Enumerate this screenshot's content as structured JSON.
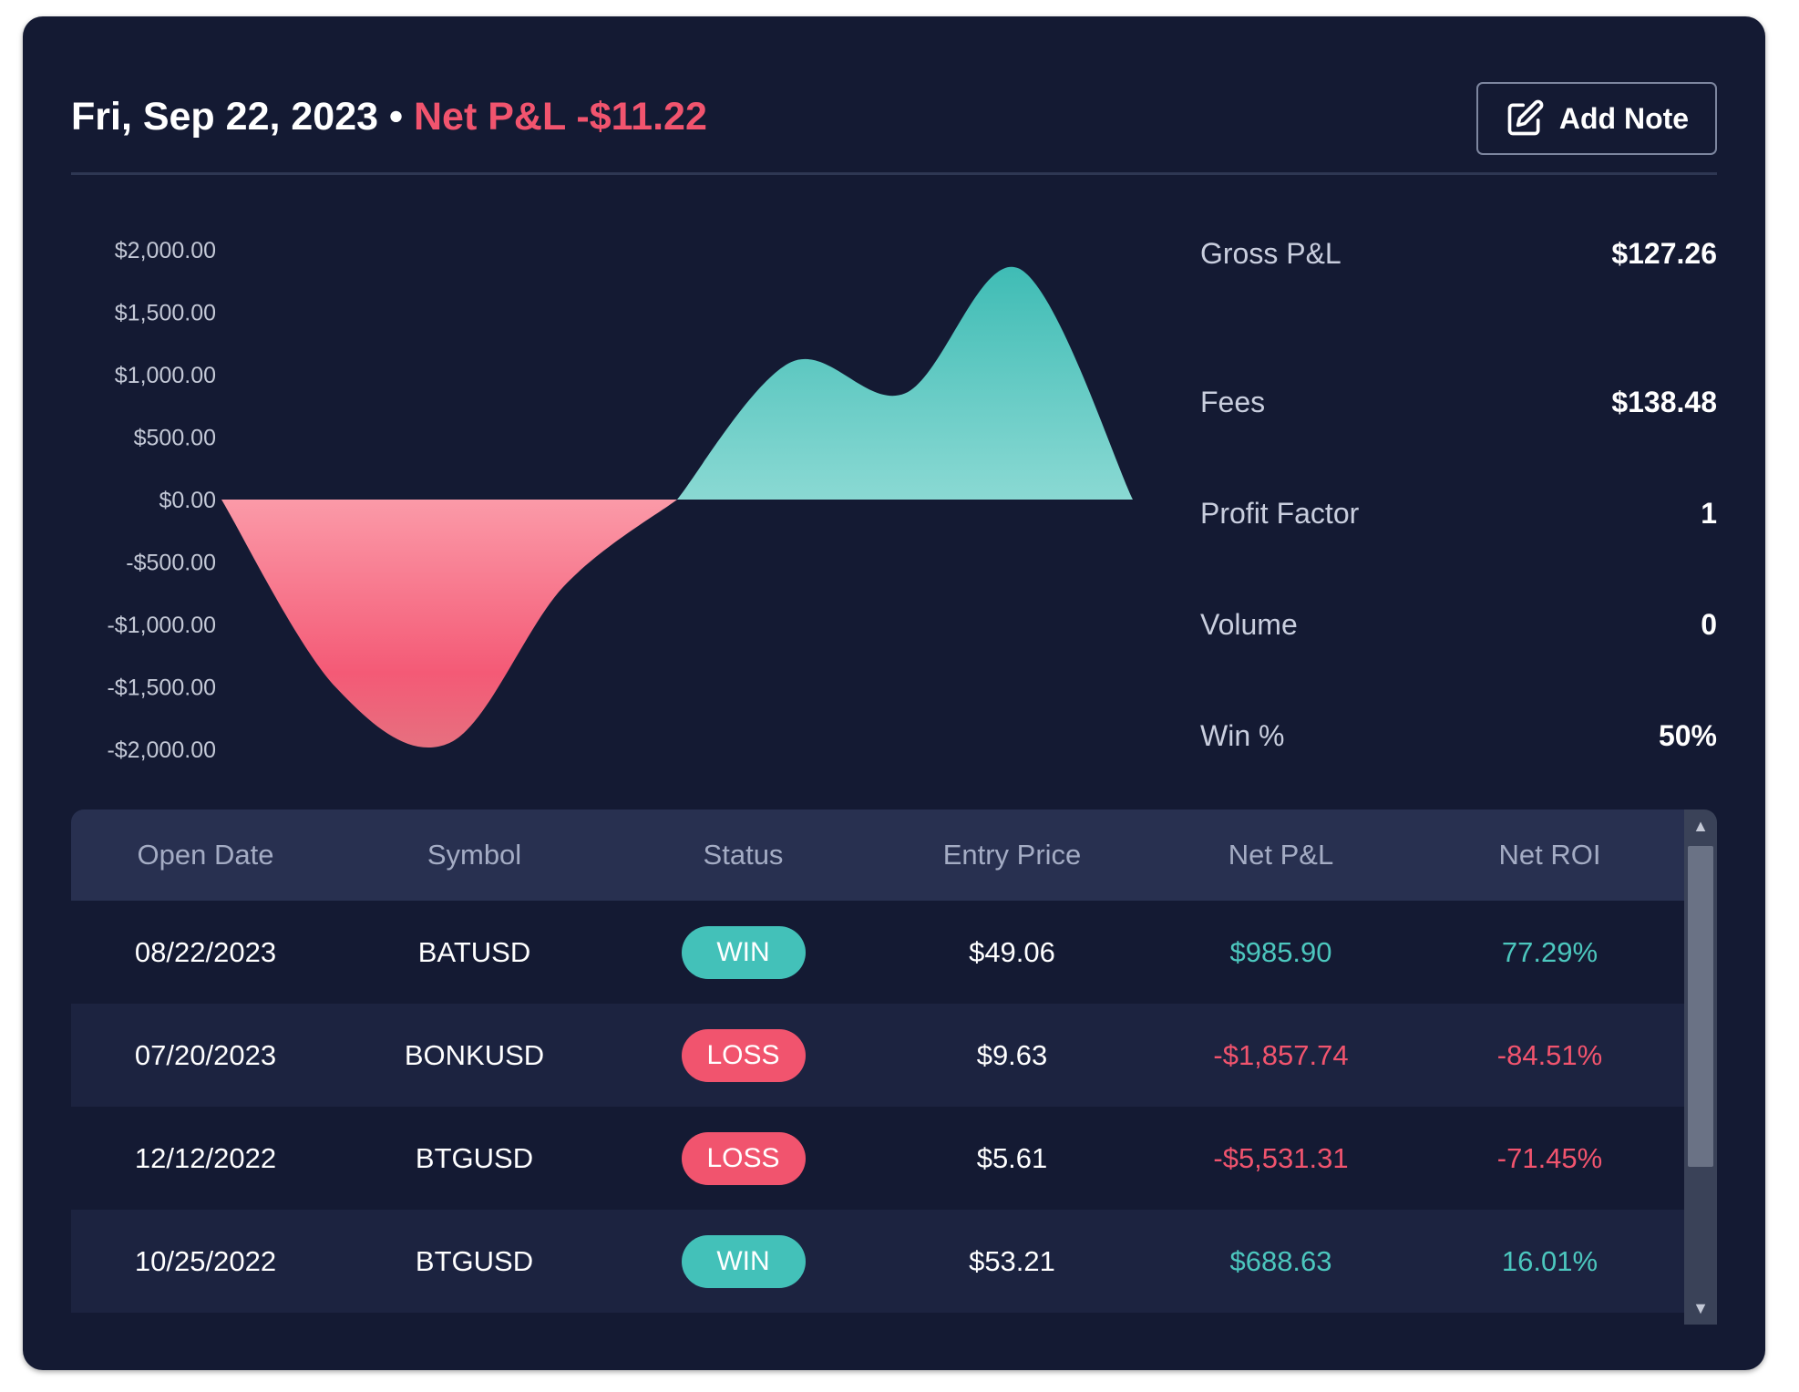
{
  "header": {
    "date": "Fri, Sep 22, 2023",
    "separator": " • ",
    "net_pnl_label": "Net P&L -$11.22",
    "add_note_label": "Add Note"
  },
  "chart_data": {
    "type": "area",
    "y_ticks": [
      "$2,000.00",
      "$1,500.00",
      "$1,000.00",
      "$500.00",
      "$0.00",
      "-$500.00",
      "-$1,000.00",
      "-$1,500.00",
      "-$2,000.00"
    ],
    "ylim": [
      -2000,
      2000
    ],
    "x": [
      0,
      1,
      2,
      3,
      4,
      5,
      6,
      7,
      8
    ],
    "values": [
      0,
      -1500,
      -1950,
      -700,
      0,
      1100,
      850,
      1850,
      0
    ],
    "colors": {
      "positive": "#4cc7be",
      "negative": "#f1546e"
    }
  },
  "stats": [
    {
      "label": "Gross P&L",
      "value": "$127.26"
    },
    {
      "label": "Fees",
      "value": "$138.48"
    },
    {
      "label": "Profit Factor",
      "value": "1"
    },
    {
      "label": "Volume",
      "value": "0"
    },
    {
      "label": "Win %",
      "value": "50%"
    }
  ],
  "table": {
    "headers": [
      "Open Date",
      "Symbol",
      "Status",
      "Entry Price",
      "Net P&L",
      "Net ROI"
    ],
    "rows": [
      {
        "open_date": "08/22/2023",
        "symbol": "BATUSD",
        "status": "WIN",
        "entry_price": "$49.06",
        "net_pnl": "$985.90",
        "net_roi": "77.29%"
      },
      {
        "open_date": "07/20/2023",
        "symbol": "BONKUSD",
        "status": "LOSS",
        "entry_price": "$9.63",
        "net_pnl": "-$1,857.74",
        "net_roi": "-84.51%"
      },
      {
        "open_date": "12/12/2022",
        "symbol": "BTGUSD",
        "status": "LOSS",
        "entry_price": "$5.61",
        "net_pnl": "-$5,531.31",
        "net_roi": "-71.45%"
      },
      {
        "open_date": "10/25/2022",
        "symbol": "BTGUSD",
        "status": "WIN",
        "entry_price": "$53.21",
        "net_pnl": "$688.63",
        "net_roi": "16.01%"
      }
    ]
  },
  "icons": {
    "add_note": "edit-note-icon",
    "scroll_up": "scroll-up-arrow-icon",
    "scroll_down": "scroll-down-arrow-icon"
  }
}
